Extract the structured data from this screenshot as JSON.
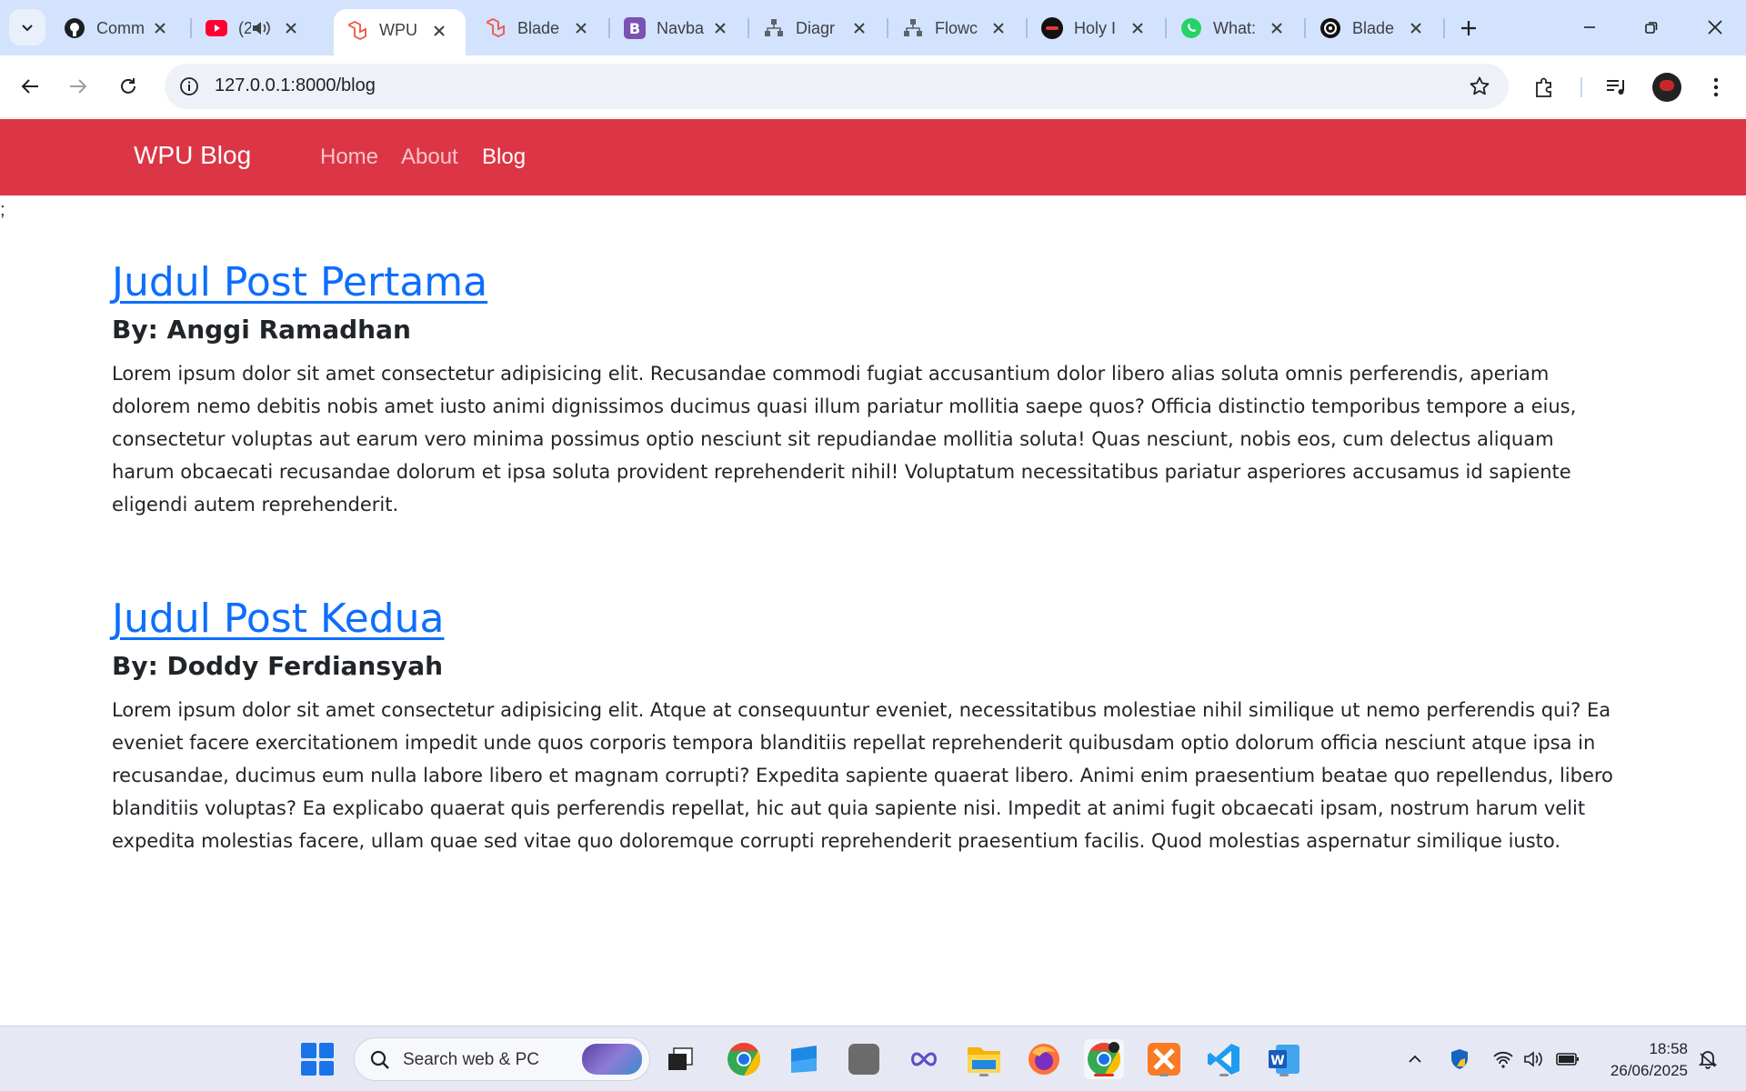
{
  "browser": {
    "tabs": [
      {
        "title": "Comm",
        "icon": "github-icon"
      },
      {
        "title": "(2",
        "icon": "youtube-icon",
        "audio": true
      },
      {
        "title": "WPU",
        "icon": "laravel-icon",
        "active": true
      },
      {
        "title": "Blade",
        "icon": "laravel-icon"
      },
      {
        "title": "Navba",
        "icon": "bootstrap-icon"
      },
      {
        "title": "Diagr",
        "icon": "diagram-icon"
      },
      {
        "title": "Flowc",
        "icon": "diagram-icon"
      },
      {
        "title": "Holy I",
        "icon": "red-logo-icon"
      },
      {
        "title": "What:",
        "icon": "whatsapp-icon"
      },
      {
        "title": "Blade",
        "icon": "openai-icon"
      }
    ],
    "url": "127.0.0.1:8000/blog"
  },
  "site": {
    "brand": "WPU Blog",
    "nav": [
      {
        "label": "Home",
        "active": false
      },
      {
        "label": "About",
        "active": false
      },
      {
        "label": "Blog",
        "active": true
      }
    ],
    "stray_text": ";",
    "accent_color": "#dc3545",
    "link_color": "#0d6efd"
  },
  "posts": [
    {
      "title": "Judul Post Pertama",
      "author": "By: Anggi Ramadhan",
      "body": "Lorem ipsum dolor sit amet consectetur adipisicing elit. Recusandae commodi fugiat accusantium dolor libero alias soluta omnis perferendis, aperiam dolorem nemo debitis nobis amet iusto animi dignissimos ducimus quasi illum pariatur mollitia saepe quos? Officia distinctio temporibus tempore a eius, consectetur voluptas aut earum vero minima possimus optio nesciunt sit repudiandae mollitia soluta! Quas nesciunt, nobis eos, cum delectus aliquam harum obcaecati recusandae dolorum et ipsa soluta provident reprehenderit nihil! Voluptatum necessitatibus pariatur asperiores accusamus id sapiente eligendi autem reprehenderit."
    },
    {
      "title": "Judul Post Kedua",
      "author": "By: Doddy Ferdiansyah",
      "body": "Lorem ipsum dolor sit amet consectetur adipisicing elit. Atque at consequuntur eveniet, necessitatibus molestiae nihil similique ut nemo perferendis qui? Ea eveniet facere exercitationem impedit unde quos corporis tempora blanditiis repellat reprehenderit quibusdam optio dolorum officia nesciunt atque ipsa in recusandae, ducimus eum nulla labore libero et magnam corrupti? Expedita sapiente quaerat libero. Animi enim praesentium beatae quo repellendus, libero blanditiis voluptas? Ea explicabo quaerat quis perferendis repellat, hic aut quia sapiente nisi. Impedit at animi fugit obcaecati ipsam, nostrum harum velit expedita molestias facere, ullam quae sed vitae quo doloremque corrupti reprehenderit praesentium facilis. Quod molestias aspernatur similique iusto."
    }
  ],
  "taskbar": {
    "search_placeholder": "Search web & PC",
    "time": "18:58",
    "date": "26/06/2025"
  }
}
